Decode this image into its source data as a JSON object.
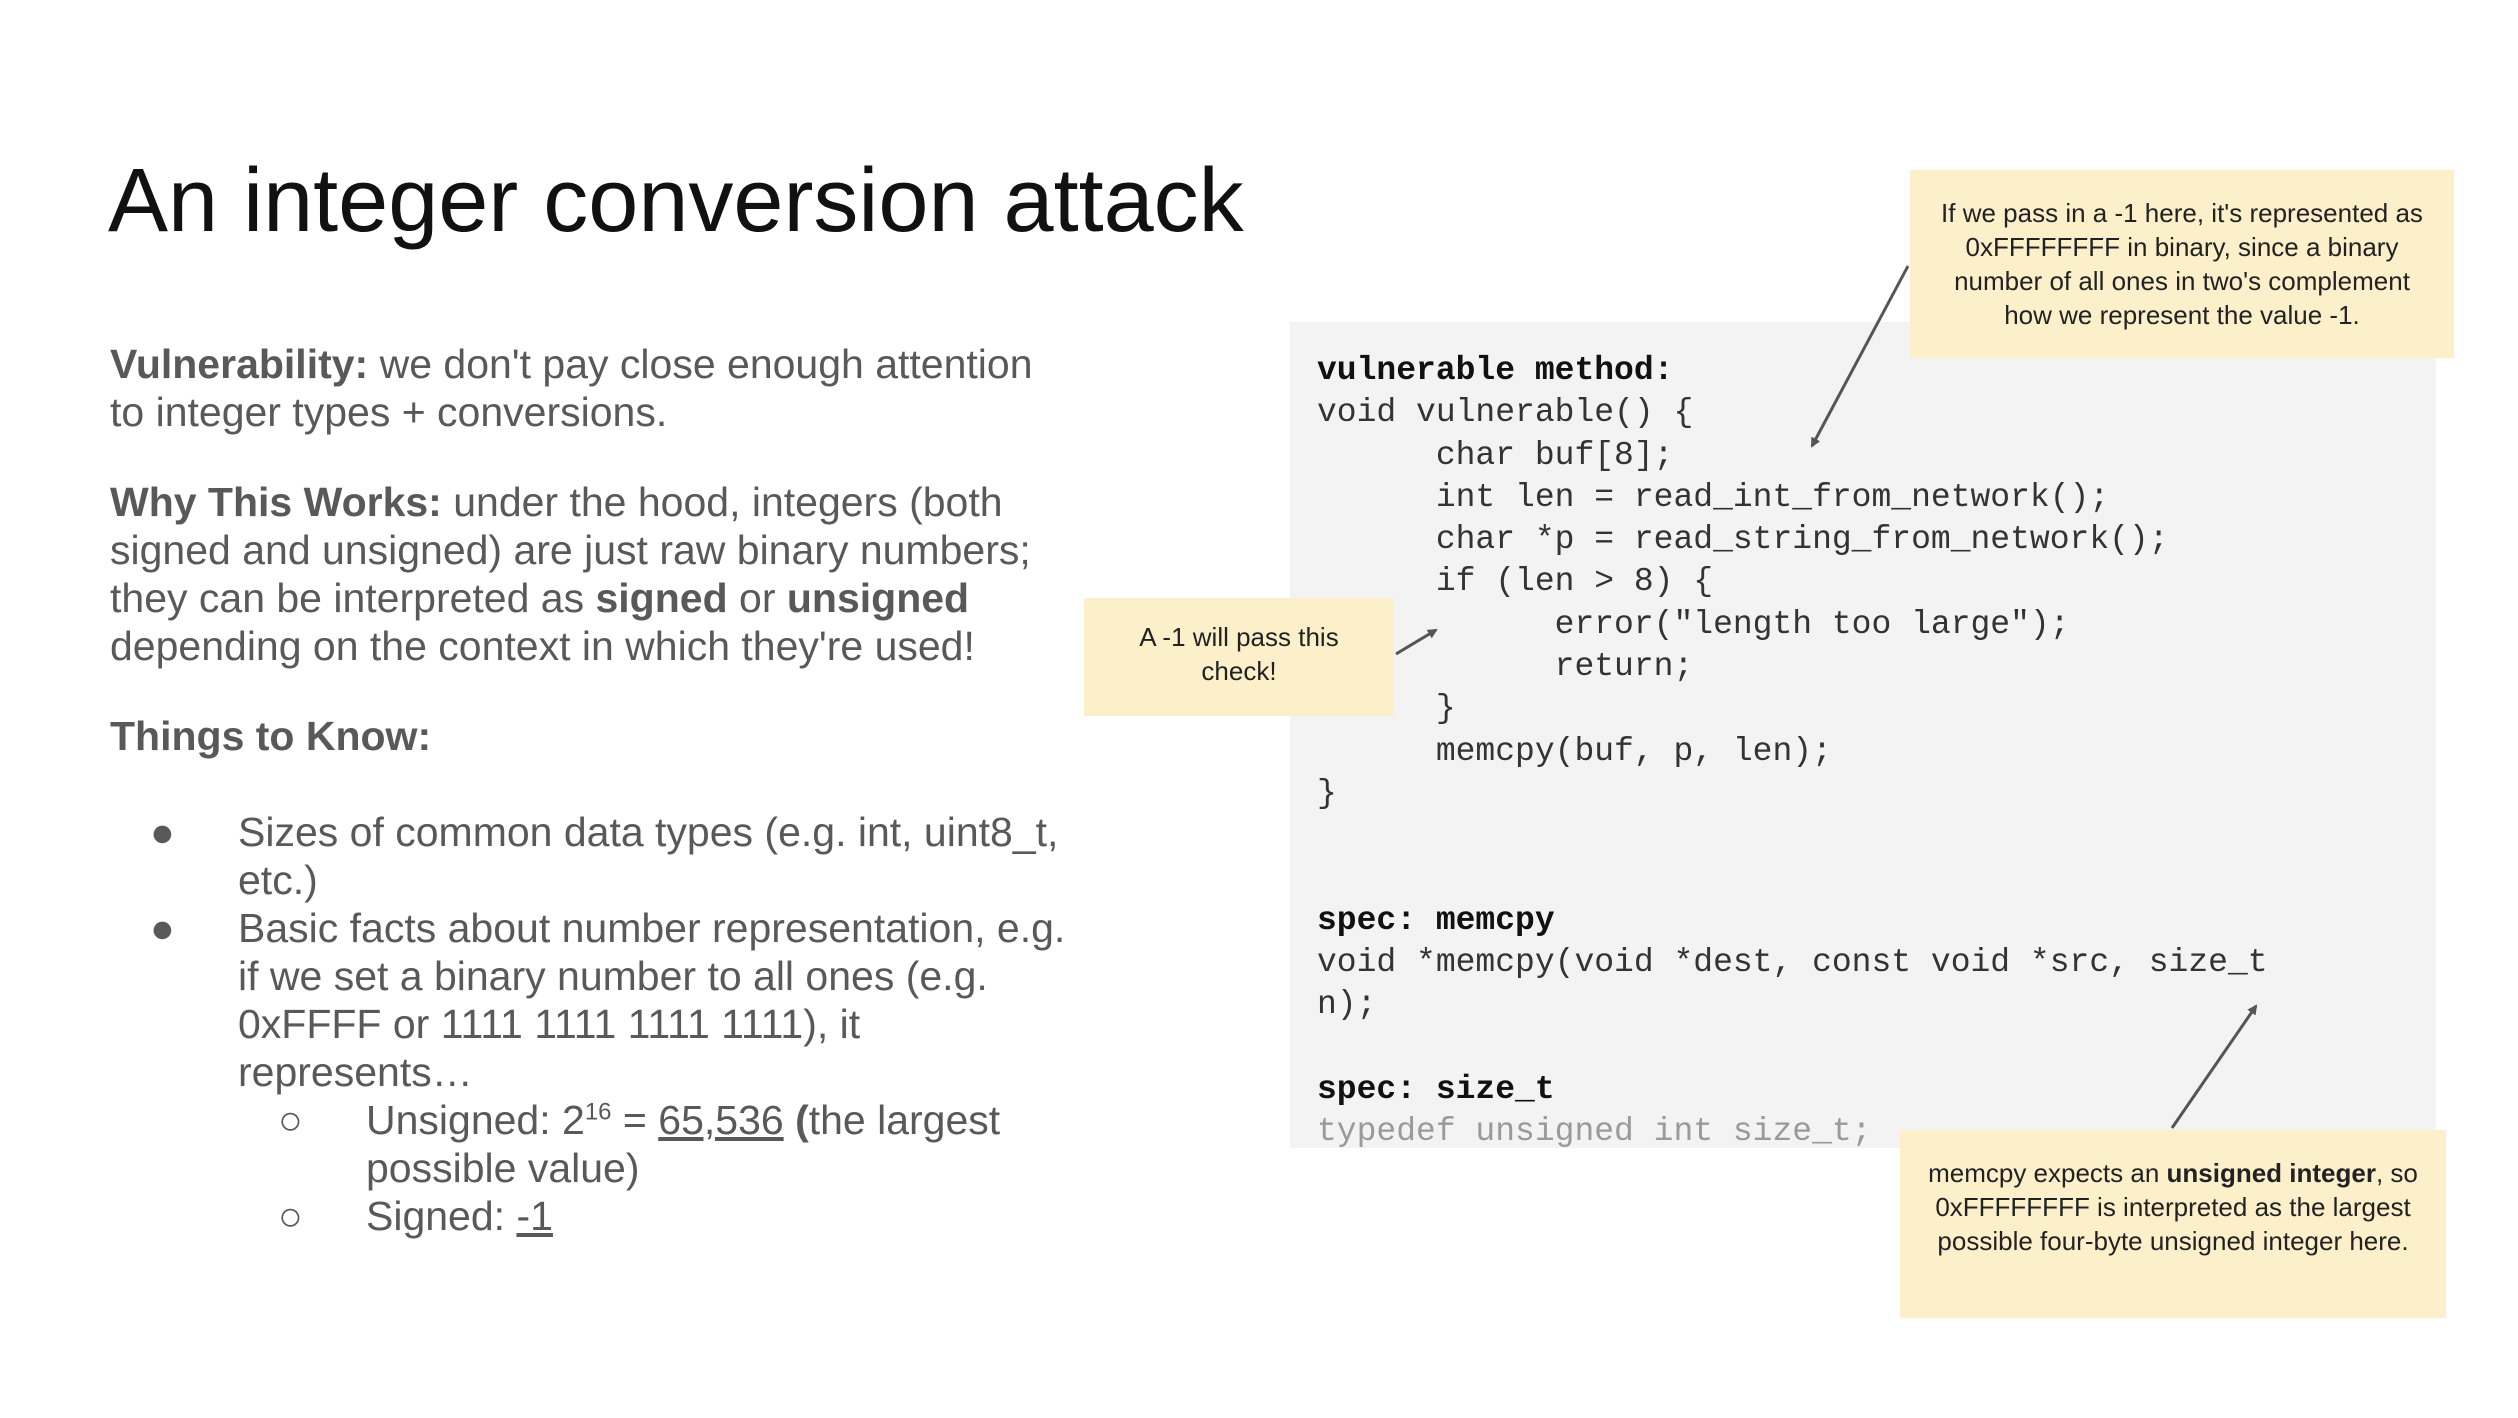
{
  "slide": {
    "title": "An integer conversion attack",
    "vulnerability": {
      "label": "Vulnerability:",
      "text": " we don't pay close enough attention to integer types + conversions."
    },
    "why": {
      "label": "Why This Works:",
      "text1": " under the hood, integers (both signed and unsigned) are just raw binary numbers; they can be interpreted as ",
      "bold1": "signed",
      "text2": " or ",
      "bold2": "unsigned",
      "text3": " depending on the context in which they're used!"
    },
    "things_heading": "Things to Know:",
    "bullets": {
      "b1": "Sizes of common data types (e.g. int, uint8_t, etc.)",
      "b2": "Basic facts about number representation, e.g. if we set a binary number to all ones (e.g. 0xFFFF or 1111 1111 1111 1111), it represents…",
      "sub1_prefix": "Unsigned: 2",
      "sub1_exp": "16",
      "sub1_eq": " = ",
      "sub1_value": "65,536",
      "sub1_paren": " (",
      "sub1_rest": "the largest possible value)",
      "sub2_prefix": "Signed: ",
      "sub2_value": "-1"
    },
    "bullet_glyph": "●",
    "sub_bullet_glyph": "○"
  },
  "code": {
    "label_vulnerable": "vulnerable method:",
    "line1": "void vulnerable() {",
    "line2": "      char buf[8];",
    "line3": "      int len = read_int_from_network();",
    "line4": "      char *p = read_string_from_network();",
    "line5": "      if (len > 8) {",
    "line6": "            error(\"length too large\");",
    "line7": "            return;",
    "line8": "      }",
    "line9": "      memcpy(buf, p, len);",
    "line10": "}",
    "label_memcpy": "spec: memcpy",
    "memcpy1": "void *memcpy(void *dest, const void *src, size_t",
    "memcpy2": "n);",
    "label_size_t": "spec: size_t",
    "size_t_line": "typedef unsigned int size_t;"
  },
  "notes": {
    "top": "If we pass in a -1 here, it's represented as 0xFFFFFFFF in binary, since a binary number of all ones in two's complement how we represent the value -1.",
    "middle": "A -1 will pass this check!",
    "bottom_prefix": "memcpy expects an ",
    "bottom_bold": "unsigned integer",
    "bottom_suffix": ", so 0xFFFFFFFF is interpreted as the largest possible four-byte unsigned integer here."
  },
  "colors": {
    "note_bg": "#fcf0cb",
    "code_bg": "#f3f3f3",
    "body_text": "#595959",
    "arrow": "#555555"
  }
}
